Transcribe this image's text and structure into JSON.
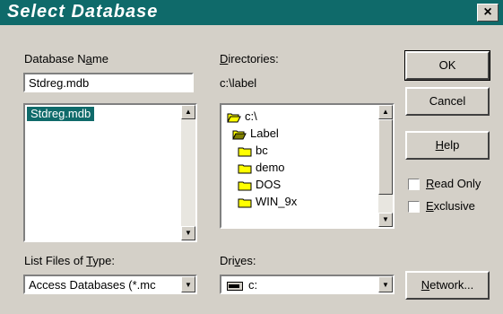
{
  "window": {
    "title": "Select Database",
    "close_glyph": "×"
  },
  "database_name": {
    "label_prefix": "Database N",
    "label_u": "a",
    "label_suffix": "me",
    "value": "Stdreg.mdb",
    "list_items": [
      "Stdreg.mdb"
    ]
  },
  "directories": {
    "label_prefix": "",
    "label_u": "D",
    "label_suffix": "irectories:",
    "current_path": "c:\\label",
    "tree": [
      {
        "name": "c:\\",
        "icon": "open-folder-icon",
        "indent": 0
      },
      {
        "name": "Label",
        "icon": "open-folder-icon",
        "indent": 1
      },
      {
        "name": "bc",
        "icon": "folder-icon",
        "indent": 2
      },
      {
        "name": "demo",
        "icon": "folder-icon",
        "indent": 2
      },
      {
        "name": "DOS",
        "icon": "folder-icon",
        "indent": 2
      },
      {
        "name": "WIN_9x",
        "icon": "folder-icon",
        "indent": 2
      }
    ]
  },
  "file_type": {
    "label_prefix": "List Files of ",
    "label_u": "T",
    "label_suffix": "ype:",
    "value": "Access Databases (*.mc"
  },
  "drives": {
    "label_prefix": "Dri",
    "label_u": "v",
    "label_suffix": "es:",
    "value": "c:"
  },
  "buttons": {
    "ok": "OK",
    "cancel": "Cancel",
    "help_prefix": "",
    "help_u": "H",
    "help_suffix": "elp",
    "network_prefix": "",
    "network_u": "N",
    "network_suffix": "etwork..."
  },
  "options": {
    "read_only_prefix": "",
    "read_only_u": "R",
    "read_only_suffix": "ead Only",
    "read_only_checked": false,
    "exclusive_prefix": "",
    "exclusive_u": "E",
    "exclusive_suffix": "xclusive",
    "exclusive_checked": false
  },
  "colors": {
    "titlebar": "#0f6a6a",
    "face": "#d4d0c8",
    "selection": "#0f6a6a",
    "folder": "#ffff00"
  }
}
